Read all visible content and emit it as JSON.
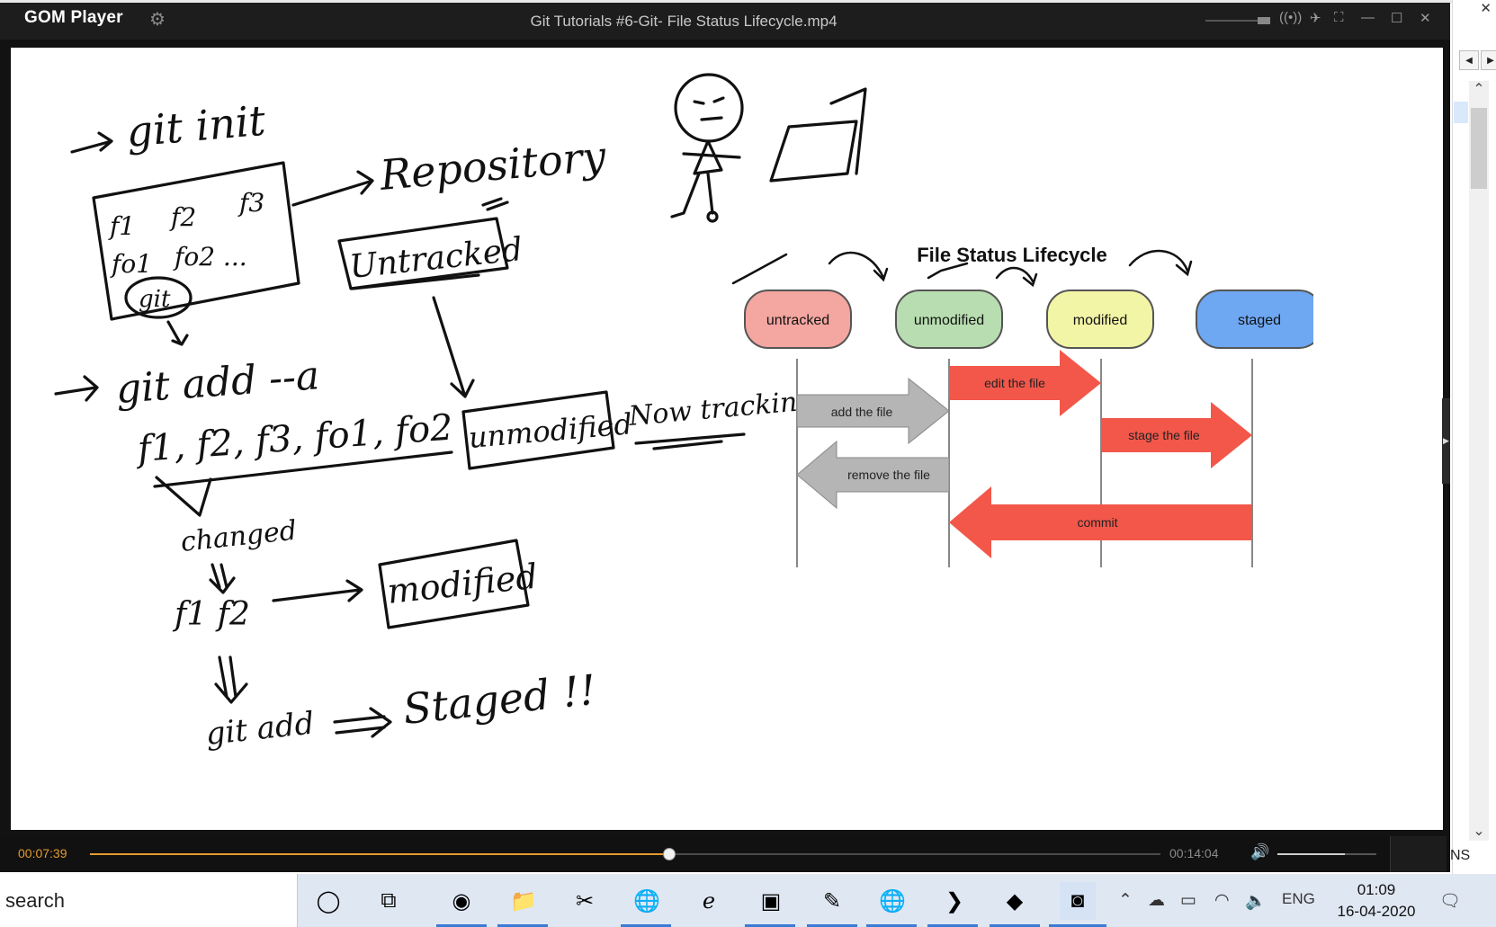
{
  "player": {
    "app_name": "GOM Player",
    "video_title": "Git Tutorials #6-Git- File Status Lifecycle.mp4",
    "time_current": "00:07:39",
    "time_total": "00:14:04",
    "progress": 0.54,
    "volume": 0.68
  },
  "whiteboard": {
    "cmd_init": "git init",
    "files_row1": [
      "f1",
      "f2",
      "f3"
    ],
    "files_row2": [
      "fo1",
      "fo2 ..."
    ],
    "git_circle": "git",
    "repository": "Repository",
    "untracked": "Untracked",
    "cmd_add_all": "git add --a",
    "file_list": "f1, f2, f3, fo1, fo2",
    "unmodified": "unmodified",
    "now_tracking": "Now tracking",
    "changed": "changed",
    "changed_files": "f1 f2",
    "modified": "modified",
    "cmd_git_add": "git add",
    "staged": "Staged !!"
  },
  "diagram": {
    "title": "File Status Lifecycle",
    "states": [
      "untracked",
      "unmodified",
      "modified",
      "staged"
    ],
    "state_colors": [
      "#f4a6a0",
      "#b8ddb0",
      "#f3f5a6",
      "#6ea7f2"
    ],
    "transitions": [
      {
        "label": "add the file",
        "from": "untracked",
        "to": "unmodified",
        "color": "#b5b5b5"
      },
      {
        "label": "edit the file",
        "from": "unmodified",
        "to": "modified",
        "color": "#f2574a"
      },
      {
        "label": "stage the file",
        "from": "modified",
        "to": "staged",
        "color": "#f2574a"
      },
      {
        "label": "remove the file",
        "from": "unmodified",
        "to": "untracked",
        "color": "#b5b5b5"
      },
      {
        "label": "commit",
        "from": "staged",
        "to": "unmodified",
        "color": "#f2574a"
      }
    ]
  },
  "taskbar": {
    "search_text": "search",
    "language": "ENG",
    "time": "01:09",
    "date": "16-04-2020"
  },
  "right_panel": {
    "fragment": "NS"
  }
}
